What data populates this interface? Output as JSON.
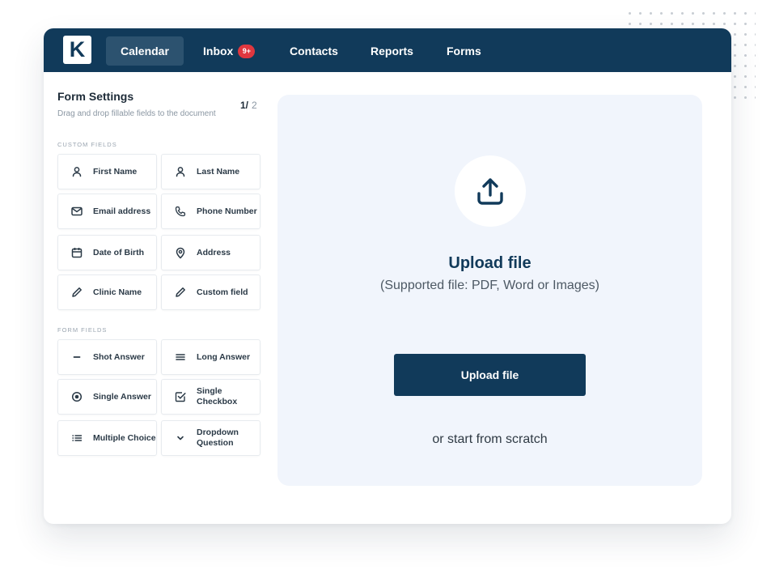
{
  "nav": {
    "logo_letter": "K",
    "items": [
      {
        "label": "Calendar",
        "active": true
      },
      {
        "label": "Inbox",
        "badge": "9+"
      },
      {
        "label": "Contacts"
      },
      {
        "label": "Reports"
      },
      {
        "label": "Forms"
      }
    ]
  },
  "panel": {
    "title": "Form Settings",
    "subtitle": "Drag and drop fillable fields to the document",
    "page_current": "1/",
    "page_total": "2",
    "custom_section": "CUSTOM FIELDS",
    "custom_fields": [
      {
        "label": "First Name",
        "icon": "person-icon"
      },
      {
        "label": "Last Name",
        "icon": "person-icon"
      },
      {
        "label": "Email address",
        "icon": "envelope-icon"
      },
      {
        "label": "Phone Number",
        "icon": "phone-icon"
      },
      {
        "label": "Date of Birth",
        "icon": "calendar-icon"
      },
      {
        "label": "Address",
        "icon": "location-pin-icon"
      },
      {
        "label": "Clinic Name",
        "icon": "pencil-icon"
      },
      {
        "label": "Custom field",
        "icon": "pencil-icon"
      }
    ],
    "form_section": "FORM FIELDS",
    "form_fields": [
      {
        "label": "Shot Answer",
        "icon": "minus-icon"
      },
      {
        "label": "Long Answer",
        "icon": "lines-icon"
      },
      {
        "label": "Single Answer",
        "icon": "radio-icon"
      },
      {
        "label": "Single Checkbox",
        "icon": "checkbox-icon"
      },
      {
        "label": "Multiple Choice",
        "icon": "list-icon"
      },
      {
        "label": "Dropdown Question",
        "icon": "chevron-down-icon"
      }
    ]
  },
  "upload": {
    "icon": "upload-icon",
    "title": "Upload file",
    "subtitle": "(Supported file: PDF, Word or Images)",
    "button": "Upload file",
    "alt_text": "or start from scratch"
  },
  "colors": {
    "nav_bg": "#113a5a",
    "badge": "#e0373f",
    "drop_bg": "#f1f5fc"
  }
}
